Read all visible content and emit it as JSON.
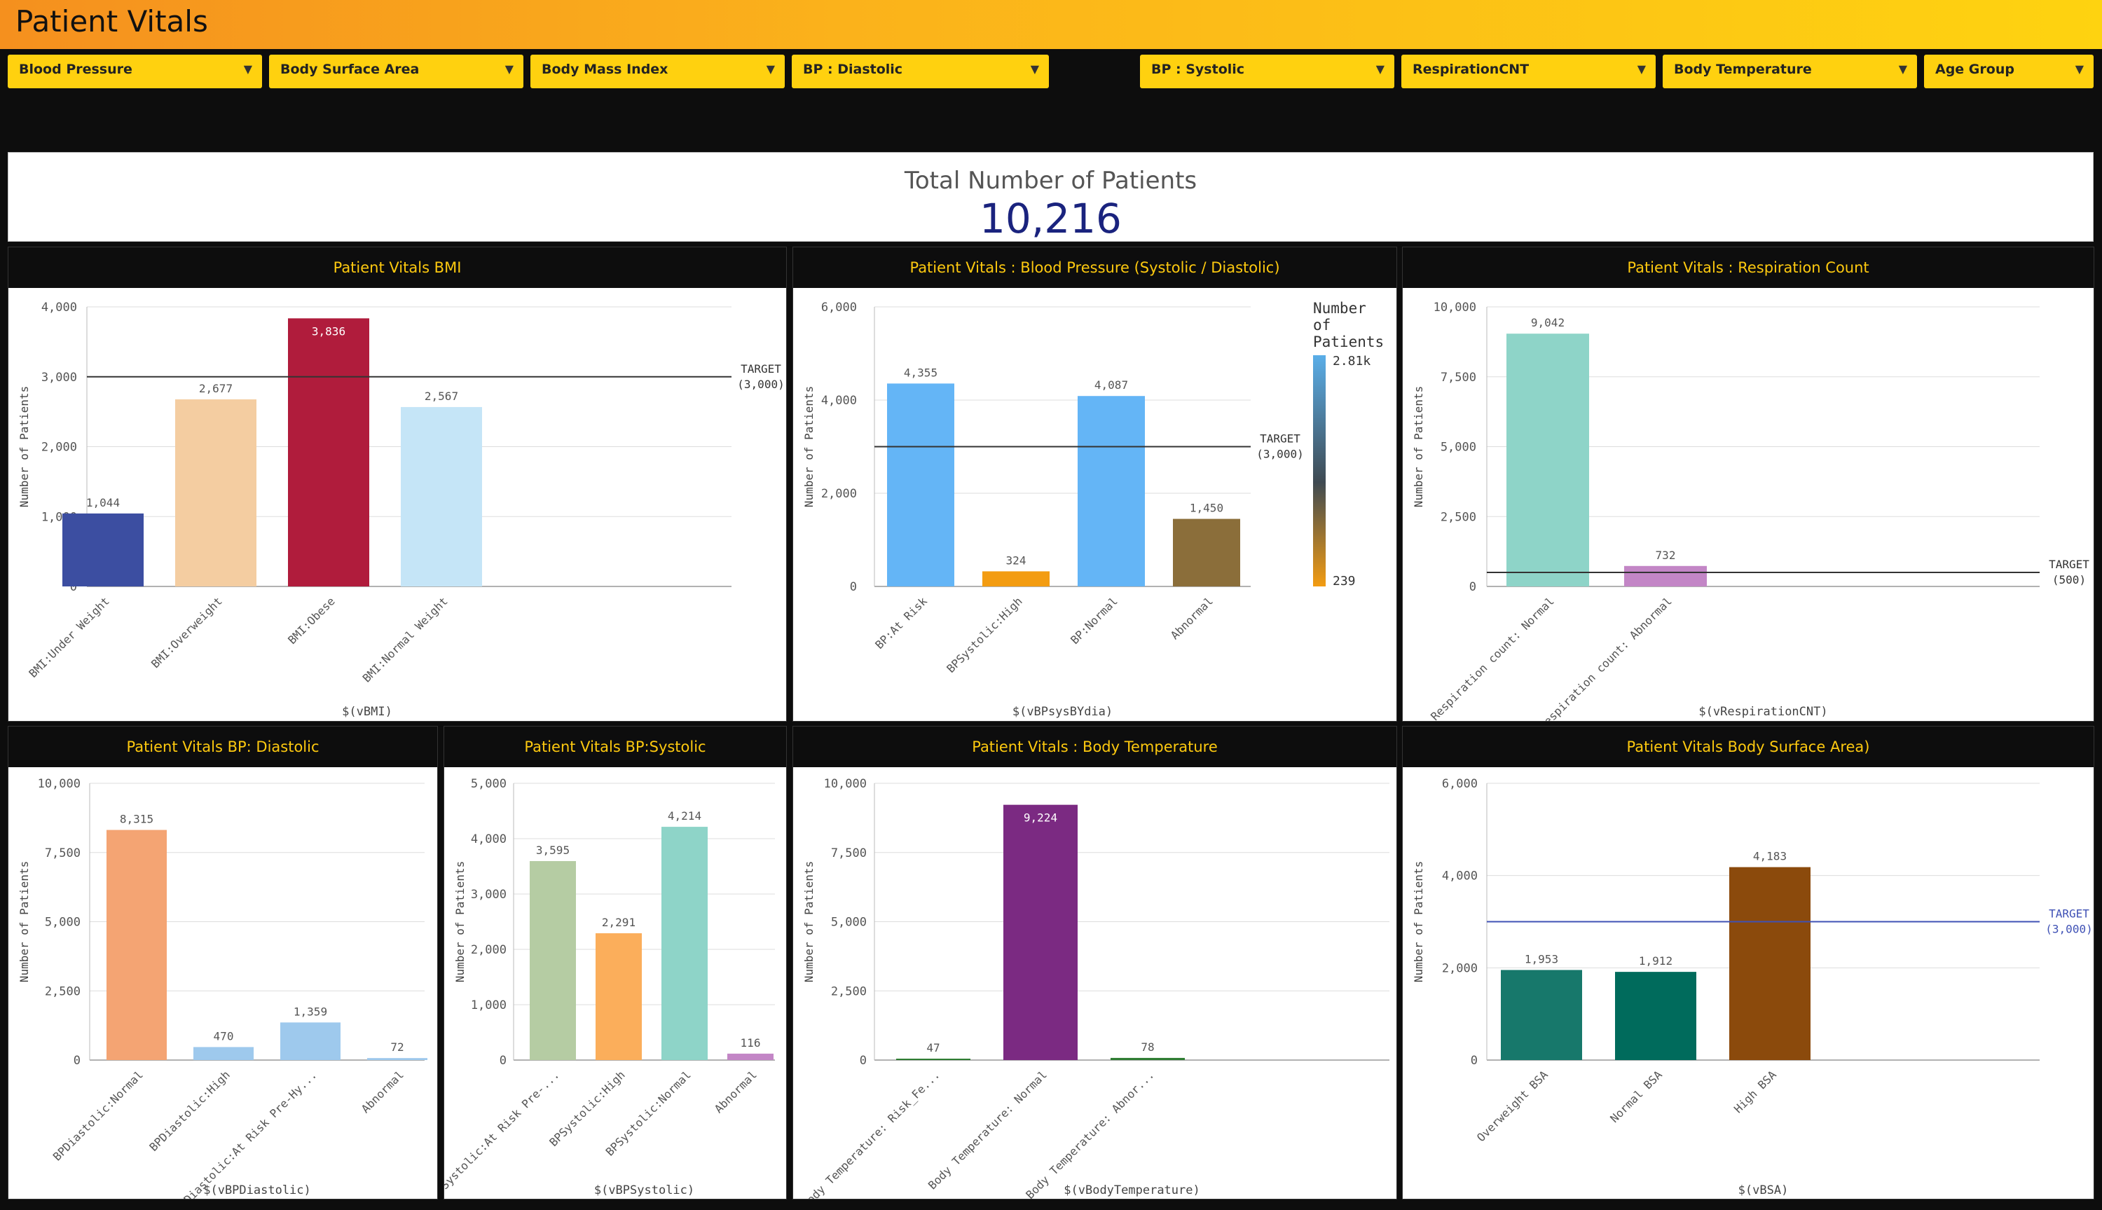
{
  "app": {
    "title": "Patient Vitals"
  },
  "filters": [
    {
      "label": "Blood Pressure"
    },
    {
      "label": "Body Surface Area"
    },
    {
      "label": "Body Mass Index"
    },
    {
      "label": "BP : Diastolic"
    },
    {
      "label": "BP : Systolic"
    },
    {
      "label": "RespirationCNT"
    },
    {
      "label": "Body Temperature"
    },
    {
      "label": "Age Group"
    }
  ],
  "kpi": {
    "title": "Total Number of Patients",
    "value": "10,216"
  },
  "colors": {
    "accent": "#fdc90f",
    "kpi_value": "#1a237e"
  },
  "chart_data": [
    {
      "id": "bmi",
      "type": "bar",
      "title": "Patient Vitals BMI",
      "xlabel": "$(vBMI)",
      "ylabel": "Number of Patients",
      "categories": [
        "BMI:Under Weight",
        "BMI:Overweight",
        "BMI:Obese",
        "BMI:Normal Weight"
      ],
      "values": [
        1044,
        2677,
        3836,
        2567
      ],
      "value_labels": [
        "1,044",
        "2,677",
        "3,836",
        "2,567"
      ],
      "colors": [
        "#3c4ea1",
        "#f4cda1",
        "#b01c3c",
        "#c5e5f7"
      ],
      "ylim": [
        0,
        4000
      ],
      "yticks": [
        "0",
        "1,000",
        "2,000",
        "3,000",
        "4,000"
      ],
      "ytick_values": [
        0,
        1000,
        2000,
        3000,
        4000
      ],
      "target": {
        "value": 3000,
        "label1": "TARGET",
        "label2": "(3,000)",
        "color": "#333333"
      },
      "grid": true
    },
    {
      "id": "bp",
      "type": "bar",
      "title": "Patient Vitals : Blood Pressure (Systolic / Diastolic)",
      "xlabel": "$(vBPsysBYdia)",
      "ylabel": "Number of Patients",
      "categories": [
        "BP:At Risk",
        "BPSystolic:High",
        "BP:Normal",
        "Abnormal"
      ],
      "values": [
        4355,
        324,
        4087,
        1450
      ],
      "value_labels": [
        "4,355",
        "324",
        "4,087",
        "1,450"
      ],
      "colors": [
        "#64b5f6",
        "#f39c12",
        "#64b5f6",
        "#8b6e3a"
      ],
      "ylim": [
        0,
        6000
      ],
      "yticks": [
        "0",
        "2,000",
        "4,000",
        "6,000"
      ],
      "ytick_values": [
        0,
        2000,
        4000,
        6000
      ],
      "target": {
        "value": 3000,
        "label1": "TARGET",
        "label2": "(3,000)",
        "color": "#333333"
      },
      "legend": {
        "title1": "Number",
        "title2": "of",
        "title3": "Patients",
        "max_label": "2.81k",
        "min_label": "239"
      },
      "grid": true
    },
    {
      "id": "resp",
      "type": "bar",
      "title": "Patient Vitals : Respiration Count",
      "xlabel": "$(vRespirationCNT)",
      "ylabel": "Number of Patients",
      "categories": [
        "Respiration count: Normal",
        "Respiration count: Abnormal"
      ],
      "values": [
        9042,
        732
      ],
      "value_labels": [
        "9,042",
        "732"
      ],
      "colors": [
        "#8ed4c8",
        "#c386c6"
      ],
      "ylim": [
        0,
        10000
      ],
      "yticks": [
        "0",
        "2,500",
        "5,000",
        "7,500",
        "10,000"
      ],
      "ytick_values": [
        0,
        2500,
        5000,
        7500,
        10000
      ],
      "target": {
        "value": 500,
        "label1": "TARGET",
        "label2": "(500)",
        "color": "#333333"
      },
      "grid": true
    },
    {
      "id": "dia",
      "type": "bar",
      "title": "Patient Vitals BP: Diastolic",
      "xlabel": "$(vBPDiastolic)",
      "ylabel": "Number of Patients",
      "categories": [
        "BPDiastolic:Normal",
        "BPDiastolic:High",
        "BPDiastolic:At Risk Pre-Hy...",
        "Abnormal"
      ],
      "values": [
        8315,
        470,
        1359,
        72
      ],
      "value_labels": [
        "8,315",
        "470",
        "1,359",
        "72"
      ],
      "colors": [
        "#f4a473",
        "#9ec9ed",
        "#9ec9ed",
        "#9ec9ed"
      ],
      "ylim": [
        0,
        10000
      ],
      "yticks": [
        "0",
        "2,500",
        "5,000",
        "7,500",
        "10,000"
      ],
      "ytick_values": [
        0,
        2500,
        5000,
        7500,
        10000
      ],
      "grid": true
    },
    {
      "id": "sys",
      "type": "bar",
      "title": "Patient Vitals BP:Systolic",
      "xlabel": "$(vBPSystolic)",
      "ylabel": "Number of Patients",
      "categories": [
        "BPSystolic:At Risk Pre-...",
        "BPSystolic:High",
        "BPSystolic:Normal",
        "Abnormal"
      ],
      "values": [
        3595,
        2291,
        4214,
        116
      ],
      "value_labels": [
        "3,595",
        "2,291",
        "4,214",
        "116"
      ],
      "colors": [
        "#b5cca3",
        "#fbae5b",
        "#8ed4c8",
        "#c386c6"
      ],
      "ylim": [
        0,
        5000
      ],
      "yticks": [
        "0",
        "1,000",
        "2,000",
        "3,000",
        "4,000",
        "5,000"
      ],
      "ytick_values": [
        0,
        1000,
        2000,
        3000,
        4000,
        5000
      ],
      "grid": true
    },
    {
      "id": "temp",
      "type": "bar",
      "title": "Patient Vitals : Body Temperature",
      "xlabel": "$(vBodyTemperature)",
      "ylabel": "Number of Patients",
      "categories": [
        "Body Temperature: Risk_Fe...",
        "Body Temperature: Normal",
        "Body Temperature: Abnor..."
      ],
      "values": [
        47,
        9224,
        78
      ],
      "value_labels": [
        "47",
        "9,224",
        "78"
      ],
      "colors": [
        "#2e7d32",
        "#7b2a82",
        "#2e7d32"
      ],
      "ylim": [
        0,
        10000
      ],
      "yticks": [
        "0",
        "2,500",
        "5,000",
        "7,500",
        "10,000"
      ],
      "ytick_values": [
        0,
        2500,
        5000,
        7500,
        10000
      ],
      "grid": true
    },
    {
      "id": "bsa",
      "type": "bar",
      "title": "Patient Vitals Body Surface Area)",
      "xlabel": "$(vBSA)",
      "ylabel": "Number of Patients",
      "categories": [
        "Overweight BSA",
        "Normal BSA",
        "High BSA"
      ],
      "values": [
        1953,
        1912,
        4183
      ],
      "value_labels": [
        "1,953",
        "1,912",
        "4,183"
      ],
      "colors": [
        "#17786b",
        "#006b5c",
        "#8b4a0c"
      ],
      "ylim": [
        0,
        6000
      ],
      "yticks": [
        "0",
        "2,000",
        "4,000",
        "6,000"
      ],
      "ytick_values": [
        0,
        2000,
        4000,
        6000
      ],
      "target": {
        "value": 3000,
        "label1": "TARGET",
        "label2": "(3,000)",
        "color": "#3f51b5"
      },
      "grid": true
    }
  ]
}
